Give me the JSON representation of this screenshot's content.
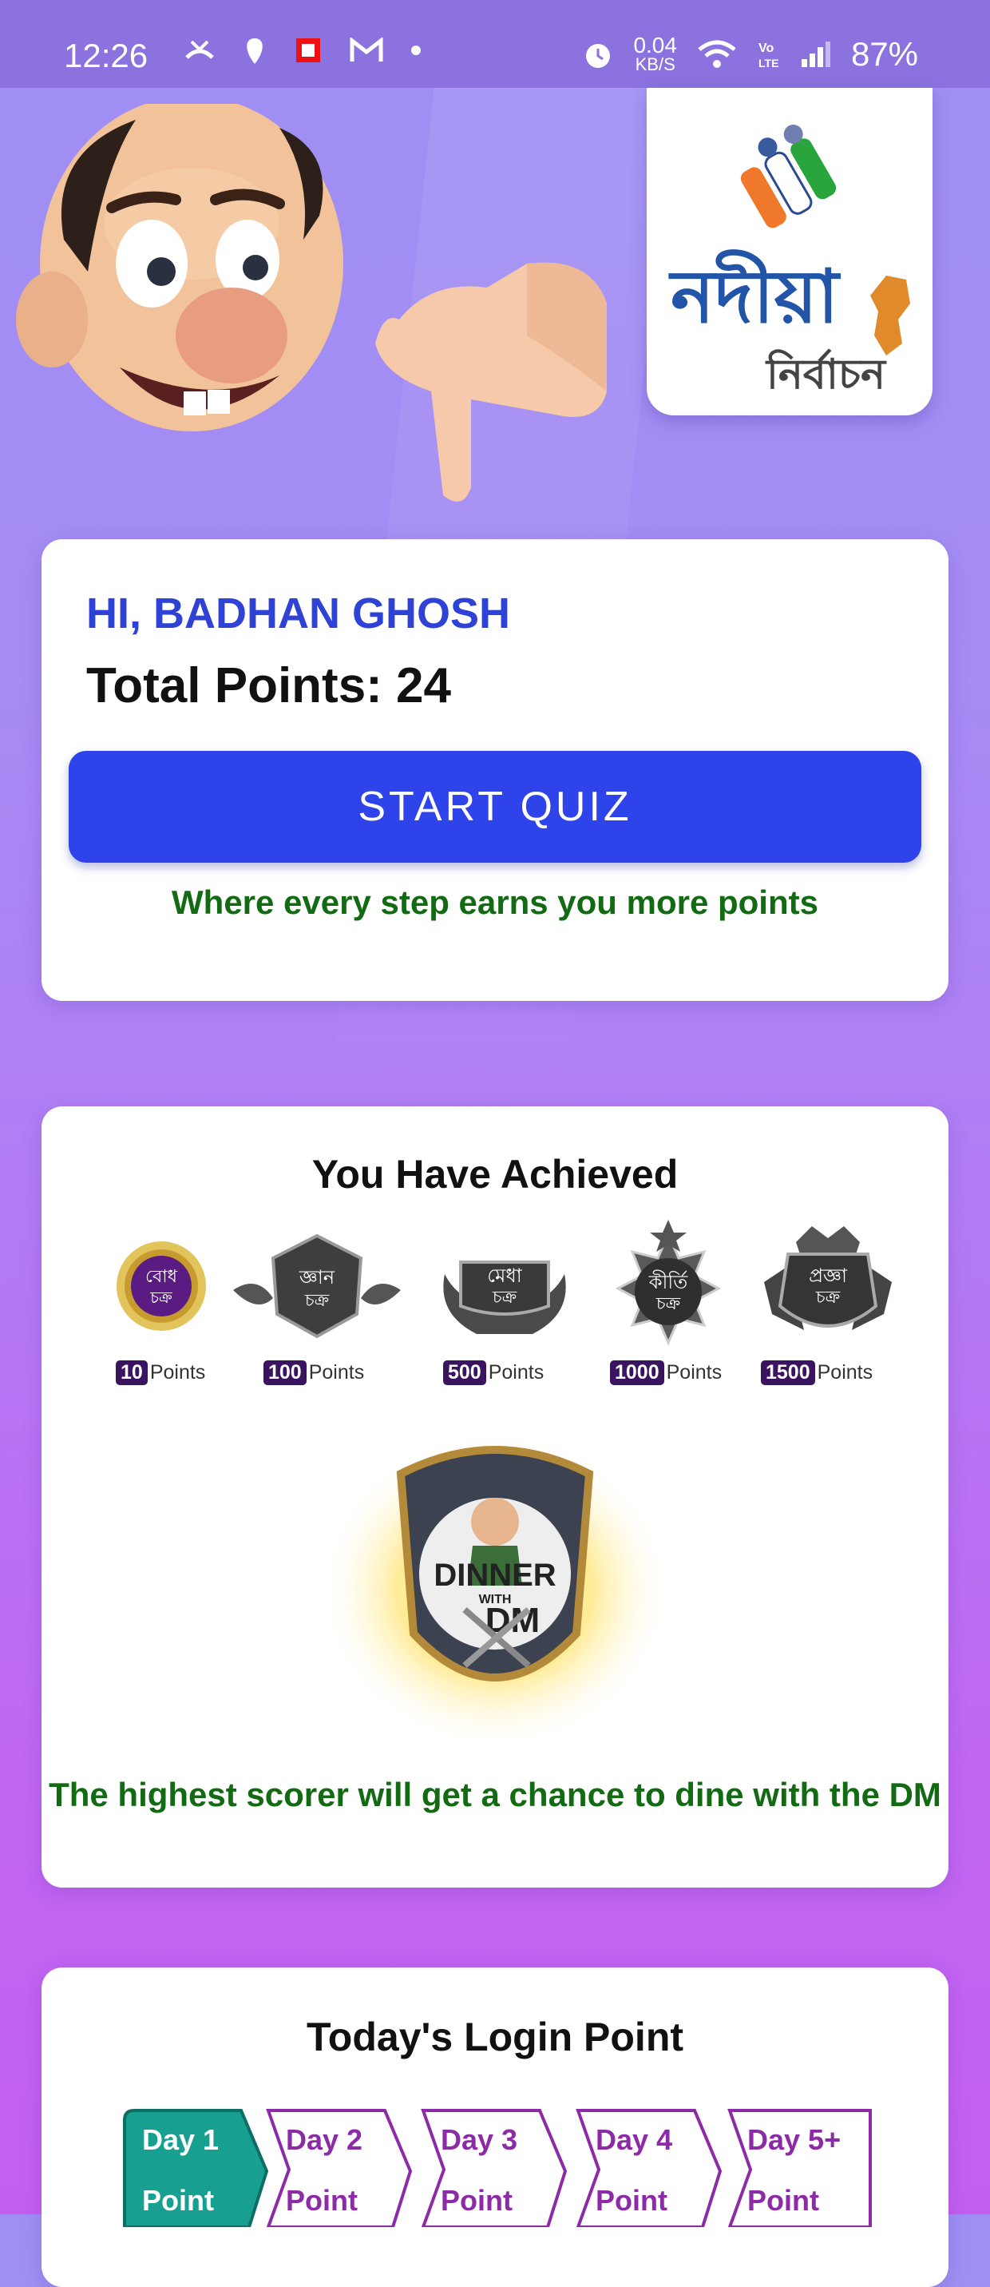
{
  "status_bar": {
    "time": "12:26",
    "net_speed_value": "0.04",
    "net_speed_unit": "KB/S",
    "battery": "87%"
  },
  "logo": {
    "title_bn": "নদীয়া",
    "subtitle_bn": "নির্বাচন"
  },
  "user_card": {
    "greeting": "HI, BADHAN GHOSH",
    "total_points_label": "Total Points: 24",
    "start_button": "START QUIZ",
    "tagline": "Where every step earns you more points"
  },
  "achievements": {
    "title": "You Have Achieved",
    "points_word": "Points",
    "badges": [
      {
        "name_bn_1": "বোধ",
        "name_bn_2": "চক্র",
        "points": "10"
      },
      {
        "name_bn_1": "জ্ঞান",
        "name_bn_2": "চক্র",
        "points": "100"
      },
      {
        "name_bn_1": "মেধা",
        "name_bn_2": "চক্র",
        "points": "500"
      },
      {
        "name_bn_1": "কীর্তি",
        "name_bn_2": "চক্র",
        "points": "1000"
      },
      {
        "name_bn_1": "প্রজ্ঞা",
        "name_bn_2": "চক্র",
        "points": "1500"
      }
    ],
    "prize_line1": "DINNER",
    "prize_line2": "WITH",
    "prize_line3": "DM",
    "prize_text": "The highest scorer will get a chance to dine with the DM"
  },
  "login": {
    "title": "Today's Login Point",
    "days": [
      {
        "label": "Day 1",
        "sub": "Point"
      },
      {
        "label": "Day 2",
        "sub": "Point"
      },
      {
        "label": "Day 3",
        "sub": "Point"
      },
      {
        "label": "Day 4",
        "sub": "Point"
      },
      {
        "label": "Day 5+",
        "sub": "Point"
      }
    ],
    "active_day": 1
  },
  "colors": {
    "accent_blue": "#2e43ea",
    "green_text": "#126a12",
    "active_day": "#17a08f",
    "day_outline": "#8c2aa7"
  }
}
